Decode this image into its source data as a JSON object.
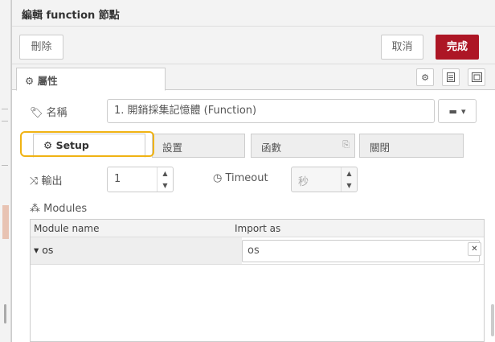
{
  "dialog": {
    "title": "編輯 function 節點"
  },
  "toolbar": {
    "delete_label": "刪除",
    "cancel_label": "取消",
    "done_label": "完成"
  },
  "properties_tab": {
    "label": "屬性"
  },
  "name_field": {
    "label": "名稱",
    "value": "1. 開銷採集記憶體 (Function)"
  },
  "tabs": [
    {
      "label": "Setup",
      "icon": "gear-icon",
      "active": true
    },
    {
      "label": "設置",
      "active": false
    },
    {
      "label": "函數",
      "icon": "file-code-icon",
      "active": false
    },
    {
      "label": "關閉",
      "active": false
    }
  ],
  "outputs": {
    "label": "輸出",
    "value": "1"
  },
  "timeout": {
    "label": "Timeout",
    "placeholder": "秒",
    "value": ""
  },
  "modules": {
    "label": "Modules",
    "columns": [
      "Module name",
      "Import as"
    ],
    "rows": [
      {
        "name": "os",
        "import_as": "os"
      }
    ]
  },
  "colors": {
    "accent": "#ad1625",
    "highlight": "#f0b313"
  }
}
